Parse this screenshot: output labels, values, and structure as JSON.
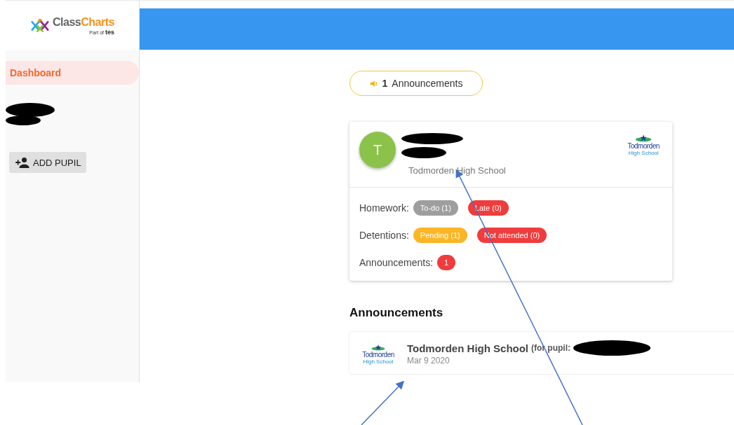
{
  "brand": {
    "name_part_1": "Class",
    "name_part_2": "Charts",
    "tagline_prefix": "Part of",
    "tagline_brand": "tes"
  },
  "sidebar": {
    "items": [
      {
        "label": "Dashboard",
        "selected": true
      }
    ],
    "add_button": "ADD PUPIL"
  },
  "announcements_button": {
    "count": "1",
    "label": "Announcements"
  },
  "pupil_card": {
    "avatar_letter": "T",
    "school": "Todmorden High School",
    "logo": {
      "line_1": "Todmorden",
      "line_2": "High School"
    },
    "rows": [
      {
        "label": "Homework:",
        "badges": [
          {
            "text": "To-do (1)",
            "color": "#9e9e9e"
          },
          {
            "text": "Late (0)",
            "color": "#f03c3c"
          }
        ]
      },
      {
        "label": "Detentions:",
        "badges": [
          {
            "text": "Pending (1)",
            "color": "#fbb626"
          },
          {
            "text": "Not attended (0)",
            "color": "#f03c3c"
          }
        ]
      },
      {
        "label": "Announcements:",
        "badges": [
          {
            "text": "1",
            "color": "#f03c3c"
          }
        ]
      }
    ]
  },
  "announcements_section": {
    "heading": "Announcements",
    "items": [
      {
        "school": "Todmorden High School",
        "for_pupil": "(for pupil:",
        "date": "Mar 9 2020",
        "logo": {
          "line_1": "Todmorden",
          "line_2": "High School"
        }
      }
    ]
  }
}
